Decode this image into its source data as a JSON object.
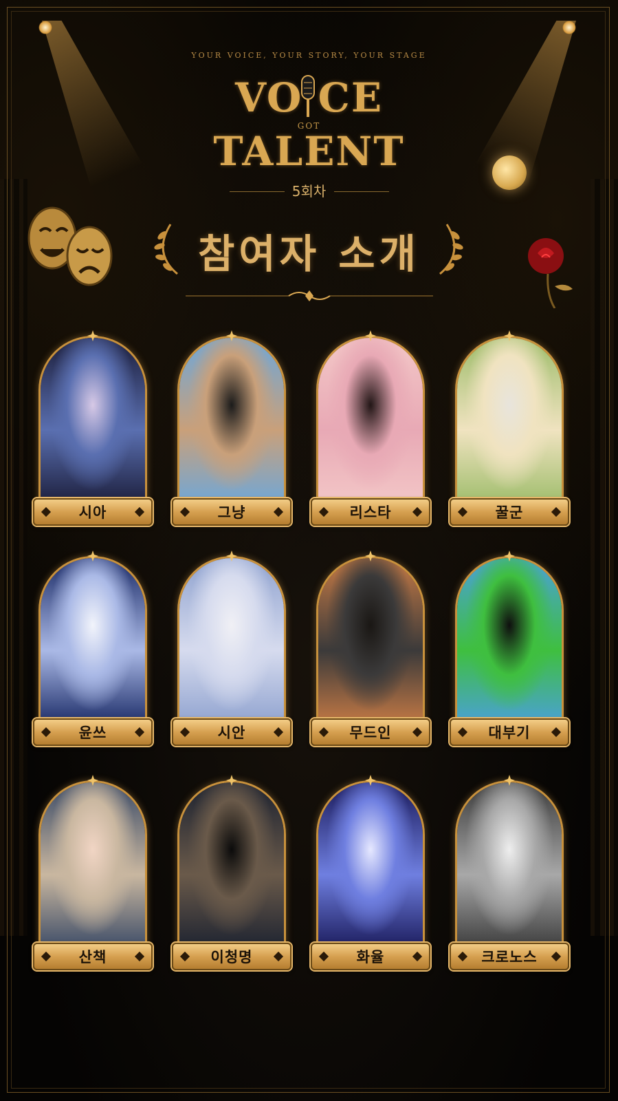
{
  "header": {
    "tagline": "YOUR VOICE, YOUR STORY, YOUR STAGE",
    "logo_line1": "VO  CE",
    "logo_got": "GOT",
    "logo_line2": "TALENT",
    "episode": "5회차",
    "section_title": "참여자 소개"
  },
  "colors": {
    "gold": "#d9a752",
    "background": "#050403"
  },
  "participants": [
    {
      "name": "시아",
      "portrait": [
        "#1b1d3a",
        "#5a6fb0",
        "#d7c9e6"
      ]
    },
    {
      "name": "그냥",
      "portrait": [
        "#6ea7d9",
        "#c9a07a",
        "#1b1b1b"
      ]
    },
    {
      "name": "리스타",
      "portrait": [
        "#f3c7c7",
        "#e8a9b5",
        "#221616"
      ]
    },
    {
      "name": "꿀군",
      "portrait": [
        "#9dbc6a",
        "#f0e3c0",
        "#e8e4dc"
      ]
    },
    {
      "name": "윤쓰",
      "portrait": [
        "#1a2a66",
        "#aab9e6",
        "#f2f4fb"
      ]
    },
    {
      "name": "시안",
      "portrait": [
        "#8fa2cf",
        "#d6dbee",
        "#f0f0f5"
      ]
    },
    {
      "name": "무드인",
      "portrait": [
        "#c67a45",
        "#3b3a3a",
        "#1a1714"
      ]
    },
    {
      "name": "대부기",
      "portrait": [
        "#4aa0d9",
        "#3fbf3f",
        "#0f0f0f"
      ]
    },
    {
      "name": "산책",
      "portrait": [
        "#3a4a66",
        "#c9b7a0",
        "#f1d5c4"
      ]
    },
    {
      "name": "이청명",
      "portrait": [
        "#1c2230",
        "#6a5a4a",
        "#0b0b0b"
      ]
    },
    {
      "name": "화율",
      "portrait": [
        "#1a1a5a",
        "#6f7fe0",
        "#e6e8ff"
      ]
    },
    {
      "name": "크로노스",
      "portrait": [
        "#3a3a3a",
        "#a8a8a8",
        "#eeeeee"
      ]
    }
  ]
}
